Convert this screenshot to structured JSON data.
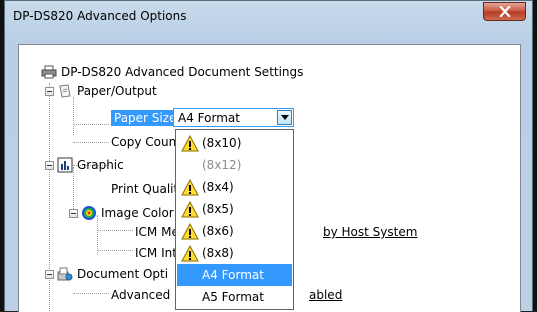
{
  "window": {
    "title": "DP-DS820 Advanced Options",
    "close_label": "Close"
  },
  "tree": {
    "root_label": "DP-DS820 Advanced Document Settings",
    "paper_output": "Paper/Output",
    "paper_size_label": "Paper Size:",
    "paper_size_value": "A4 Format",
    "copy_count": "Copy Count",
    "graphic": "Graphic",
    "print_quality": "Print Quality",
    "image_color": "Image Color",
    "icm_method": "ICM Met",
    "icm_method_value": "by Host System",
    "icm_intent": "ICM Inte",
    "document_options": "Document Opti",
    "advanced_p": "Advanced P",
    "advanced_value": "abled"
  },
  "dropdown": {
    "options": [
      {
        "label": "(8x10)",
        "warning": true,
        "state": "normal"
      },
      {
        "label": "(8x12)",
        "warning": false,
        "state": "disabled"
      },
      {
        "label": "(8x4)",
        "warning": true,
        "state": "normal"
      },
      {
        "label": "(8x5)",
        "warning": true,
        "state": "normal"
      },
      {
        "label": "(8x6)",
        "warning": true,
        "state": "normal"
      },
      {
        "label": "(8x8)",
        "warning": true,
        "state": "normal"
      },
      {
        "label": "A4 Format",
        "warning": false,
        "state": "highlighted"
      },
      {
        "label": "A5 Format",
        "warning": false,
        "state": "normal"
      }
    ]
  },
  "colors": {
    "selection": "#3399ff",
    "window_frame": "#bcd0e5",
    "close_red": "#c6523c",
    "warning_yellow": "#ffdd33"
  }
}
